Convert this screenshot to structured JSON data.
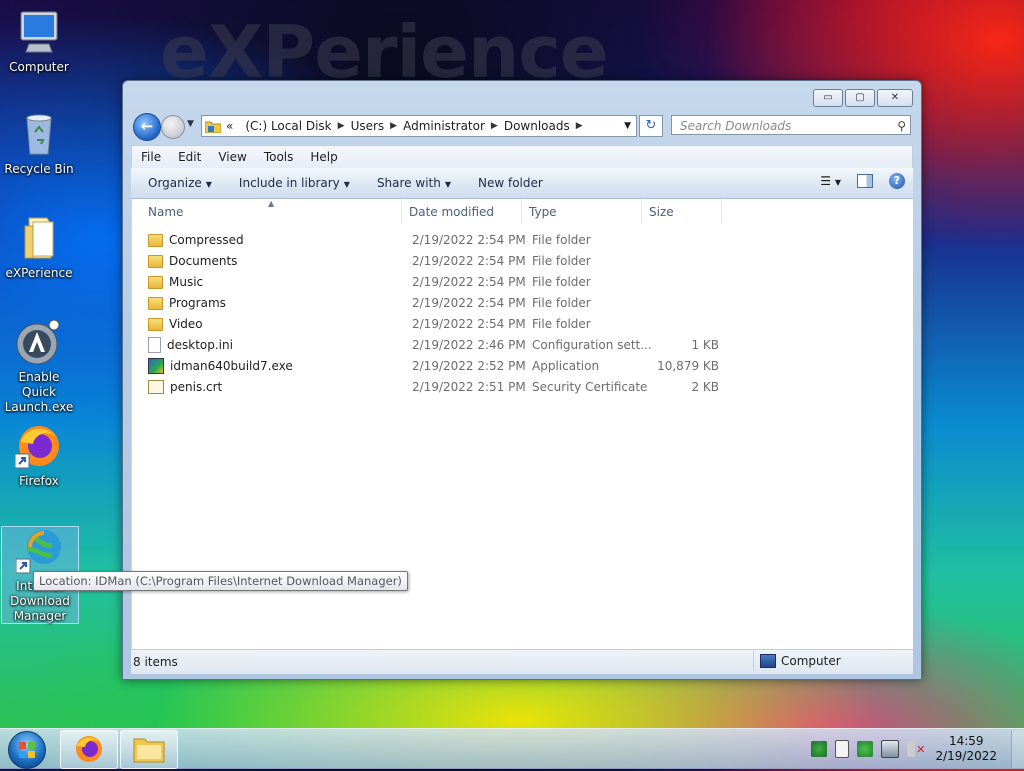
{
  "desktop": {
    "watermark": "eXPerience",
    "icons": [
      {
        "label": "Computer"
      },
      {
        "label": "Recycle Bin"
      },
      {
        "label": "eXPerience"
      },
      {
        "label": "Enable Quick Launch.exe"
      },
      {
        "label": "Firefox"
      },
      {
        "label": "Internet Download Manager"
      }
    ]
  },
  "tooltip": "Location: IDMan (C:\\Program Files\\Internet Download Manager)",
  "window": {
    "controls": {
      "minimize": "▭",
      "maximize": "▢",
      "close": "✕"
    },
    "address": {
      "overflow": "«",
      "crumbs": [
        "(C:) Local Disk",
        "Users",
        "Administrator",
        "Downloads"
      ]
    },
    "search": {
      "placeholder": "Search Downloads"
    },
    "menu": {
      "file": "File",
      "edit": "Edit",
      "view": "View",
      "tools": "Tools",
      "help": "Help"
    },
    "commands": {
      "organize": "Organize",
      "include": "Include in library",
      "share": "Share with",
      "new_folder": "New folder"
    },
    "columns": {
      "name": "Name",
      "date": "Date modified",
      "type": "Type",
      "size": "Size"
    },
    "files": [
      {
        "name": "Compressed",
        "date": "2/19/2022 2:54 PM",
        "type": "File folder",
        "size": "",
        "icon": "folder-icon"
      },
      {
        "name": "Documents",
        "date": "2/19/2022 2:54 PM",
        "type": "File folder",
        "size": "",
        "icon": "folder-icon"
      },
      {
        "name": "Music",
        "date": "2/19/2022 2:54 PM",
        "type": "File folder",
        "size": "",
        "icon": "folder-icon"
      },
      {
        "name": "Programs",
        "date": "2/19/2022 2:54 PM",
        "type": "File folder",
        "size": "",
        "icon": "folder-icon"
      },
      {
        "name": "Video",
        "date": "2/19/2022 2:54 PM",
        "type": "File folder",
        "size": "",
        "icon": "folder-icon"
      },
      {
        "name": "desktop.ini",
        "date": "2/19/2022 2:46 PM",
        "type": "Configuration sett...",
        "size": "1 KB",
        "icon": "settings-file-icon"
      },
      {
        "name": "idman640build7.exe",
        "date": "2/19/2022 2:52 PM",
        "type": "Application",
        "size": "10,879 KB",
        "icon": "application-icon"
      },
      {
        "name": "penis.crt",
        "date": "2/19/2022 2:51 PM",
        "type": "Security Certificate",
        "size": "2 KB",
        "icon": "certificate-icon"
      }
    ],
    "status": {
      "count": "8 items",
      "location": "Computer"
    }
  },
  "taskbar": {
    "time": "14:59",
    "date": "2/19/2022"
  }
}
